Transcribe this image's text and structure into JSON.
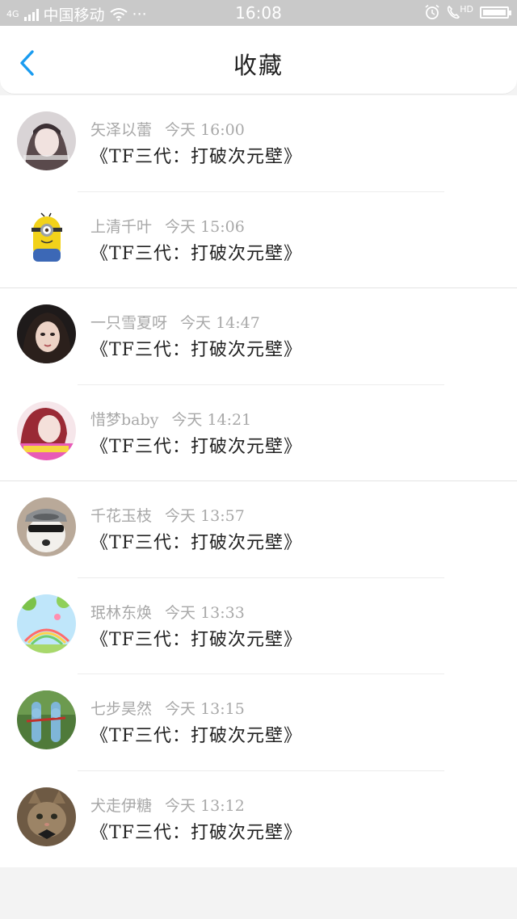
{
  "status_bar": {
    "carrier": "中国移动",
    "signal_label": "4G",
    "dots": "···",
    "time": "16:08",
    "call_label": "HD"
  },
  "header": {
    "title": "收藏",
    "back_icon": "chevron-left-icon"
  },
  "colors": {
    "accent": "#1a9cf0",
    "meta_text": "#a8a8a8",
    "title_text": "#222222"
  },
  "items": [
    {
      "user": "矢泽以蕾",
      "day": "今天",
      "time": "16:00",
      "title": "《TF三代：打破次元壁》"
    },
    {
      "user": "上清千叶",
      "day": "今天",
      "time": "15:06",
      "title": "《TF三代：打破次元壁》"
    },
    {
      "user": "一只雪夏呀",
      "day": "今天",
      "time": "14:47",
      "title": "《TF三代：打破次元壁》"
    },
    {
      "user": "惜梦baby",
      "day": "今天",
      "time": "14:21",
      "title": "《TF三代：打破次元壁》"
    },
    {
      "user": "千花玉枝",
      "day": "今天",
      "time": "13:57",
      "title": "《TF三代：打破次元壁》"
    },
    {
      "user": "珉林东焕",
      "day": "今天",
      "time": "13:33",
      "title": "《TF三代：打破次元壁》"
    },
    {
      "user": "七步昊然",
      "day": "今天",
      "time": "13:15",
      "title": "《TF三代：打破次元壁》"
    },
    {
      "user": "犬走伊糖",
      "day": "今天",
      "time": "13:12",
      "title": "《TF三代：打破次元壁》"
    }
  ]
}
